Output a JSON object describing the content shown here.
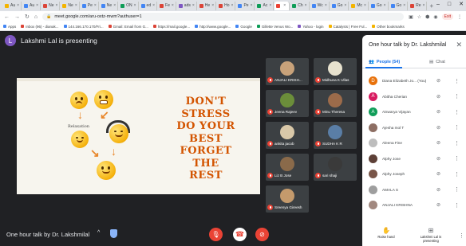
{
  "browser": {
    "tabs": [
      {
        "label": "Au",
        "color": "#f4b400"
      },
      {
        "label": "Au",
        "color": "#4285f4"
      },
      {
        "label": "Ne",
        "color": "#db4437"
      },
      {
        "label": "Ne",
        "color": "#f4b400"
      },
      {
        "label": "Pe",
        "color": "#4285f4"
      },
      {
        "label": "Ne",
        "color": "#4285f4"
      },
      {
        "label": "ON",
        "color": "#0f9d58"
      },
      {
        "label": "ed",
        "color": "#4285f4"
      },
      {
        "label": "Fe",
        "color": "#db4437"
      },
      {
        "label": "ads",
        "color": "#7e57c2"
      },
      {
        "label": "He",
        "color": "#db4437"
      },
      {
        "label": "Ho",
        "color": "#db4437"
      },
      {
        "label": "Pe",
        "color": "#4285f4"
      },
      {
        "label": "Ac",
        "color": "#0f9d58"
      },
      {
        "label": "",
        "color": "#ea4335",
        "active": true
      },
      {
        "label": "Ch",
        "color": "#0f9d58"
      },
      {
        "label": "Wc",
        "color": "#4285f4"
      },
      {
        "label": "Go",
        "color": "#4285f4"
      },
      {
        "label": "Mc",
        "color": "#f4b400"
      },
      {
        "label": "Go",
        "color": "#4285f4"
      },
      {
        "label": "Go",
        "color": "#4285f4"
      },
      {
        "label": "Re",
        "color": "#db4437"
      }
    ],
    "new_tab": "+",
    "window_controls": {
      "minimize": "–",
      "maximize": "□",
      "close": "✕"
    },
    "url": "meet.google.com/aru-oxtz-mwm?authuser=1",
    "exit_label": "Exit",
    "bookmarks": [
      {
        "label": "Apps",
        "color": "#4285f4"
      },
      {
        "label": "Inbox (96) - dianak...",
        "color": "#db4437"
      },
      {
        "label": "144.166.170.170/Fri...",
        "color": "#4285f4"
      },
      {
        "label": "Gmail: Email from G...",
        "color": "#db4437"
      },
      {
        "label": "https://mail.google...",
        "color": "#db4437"
      },
      {
        "label": "http://www.google...",
        "color": "#4285f4"
      },
      {
        "label": "Google",
        "color": "#4285f4"
      },
      {
        "label": "Gillette Venus Wo...",
        "color": "#0f9d58"
      },
      {
        "label": "Yahoo - login",
        "color": "#7e57c2"
      },
      {
        "label": "Catalysts | Free Ful...",
        "color": "#f4b400"
      },
      {
        "label": "Other bookmarks",
        "color": "#f4b400"
      }
    ]
  },
  "meet": {
    "presenter": {
      "initial": "L",
      "text": "Lakshmi Lal is presenting",
      "color": "#7e57c2"
    },
    "slide": {
      "relax_label": "Relaxation",
      "quote_lines": [
        "DON'T",
        "STRESS",
        "DO YOUR",
        "BEST",
        "FORGET",
        "THE",
        "REST"
      ]
    },
    "tiles": [
      {
        "name": "ANJALI KRISH...",
        "color": "#c8a27a"
      },
      {
        "name": "Midhuna K Ullas",
        "color": "#e8e3cf"
      },
      {
        "name": "Jeena Rajeev",
        "color": "#6b8e3a"
      },
      {
        "name": "Minu Theresa",
        "color": "#9c6b4a"
      },
      {
        "name": "ankita jacob",
        "color": "#d9c8a8"
      },
      {
        "name": "SUDHA K R",
        "color": "#5a7ea6"
      },
      {
        "name": "Liz B Jose",
        "color": "#8a6a4a"
      },
      {
        "name": "sari shaji",
        "color": "#3a3a3a"
      },
      {
        "name": "Sreenya Gireesh",
        "color": "#c49a6c"
      }
    ],
    "title": "One hour talk by Dr. Lakshmilal",
    "bottom_actions": {
      "raise_hand": "Raise hand",
      "presenting": "Lakshmi Lal is presenting"
    }
  },
  "panel": {
    "title": "One hour talk by Dr. Lakshmilal",
    "people_tab": "People (54)",
    "chat_tab": "Chat",
    "participants": [
      {
        "initial": "D",
        "name": "Diana Elizabeth Jo... (You)",
        "color": "#e8710a"
      },
      {
        "initial": "A",
        "name": "Abitha Cherian",
        "color": "#d81b60"
      },
      {
        "initial": "A",
        "name": "Aiswarya Vijayan",
        "color": "#0f9d58"
      },
      {
        "initial": "",
        "name": "Ajesha mol T",
        "color": "#8d6e63"
      },
      {
        "initial": "",
        "name": "Aleena Fine",
        "color": "#bdbdbd"
      },
      {
        "initial": "",
        "name": "Alphy Jose",
        "color": "#5d4037"
      },
      {
        "initial": "",
        "name": "Alphy Joseph",
        "color": "#795548"
      },
      {
        "initial": "",
        "name": "AMALA S",
        "color": "#9e9e9e"
      },
      {
        "initial": "",
        "name": "ANJALI KRISHNA",
        "color": "#a1887f"
      }
    ]
  }
}
